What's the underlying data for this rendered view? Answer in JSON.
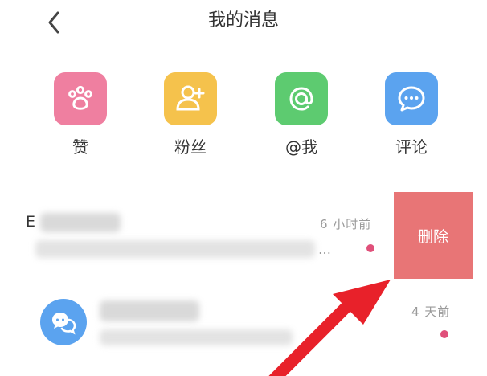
{
  "header": {
    "title": "我的消息",
    "back_icon": "chevron-left-icon"
  },
  "categories": [
    {
      "label": "赞",
      "icon": "paw-icon",
      "color": "#ef7fa0"
    },
    {
      "label": "粉丝",
      "icon": "add-user-icon",
      "color": "#f5c24c"
    },
    {
      "label": "@我",
      "icon": "at-icon",
      "color": "#5dcb70"
    },
    {
      "label": "评论",
      "icon": "chat-bubble-icon",
      "color": "#5ba3ef"
    }
  ],
  "messages": [
    {
      "name_prefix": "E",
      "time": "6 小时前",
      "preview_suffix": "…",
      "unread": true
    },
    {
      "time": "4 天前",
      "avatar_icon": "chat-bubbles-icon",
      "unread": true
    }
  ],
  "delete_action": {
    "label": "删除",
    "color": "#e87576"
  },
  "annotation": {
    "icon": "red-arrow-icon",
    "color": "#e8212a"
  }
}
